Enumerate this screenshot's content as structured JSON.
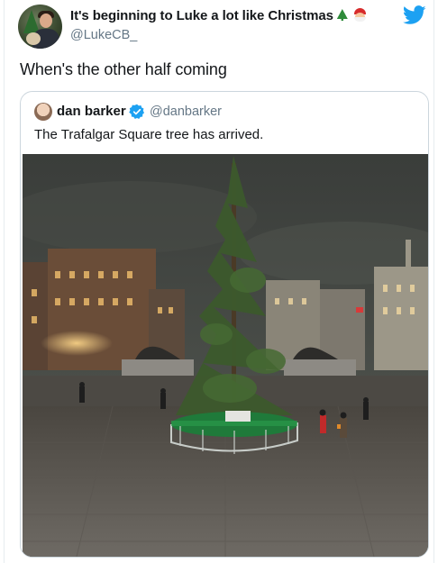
{
  "tweet": {
    "author": {
      "display_name": "It's beginning to Luke a lot like Christmas",
      "handle": "@LukeCB_",
      "name_emojis": [
        "christmas-tree-emoji",
        "santa-emoji"
      ]
    },
    "text": "When's the other half coming",
    "logo_icon": "twitter-bird-icon",
    "brand_color": "#1da1f2"
  },
  "quoted_tweet": {
    "author": {
      "display_name": "dan barker",
      "handle": "@danbarker",
      "verified": true,
      "verified_icon": "verified-badge-icon"
    },
    "text": "The Trafalgar Square tree has arrived.",
    "media": {
      "type": "photo",
      "subject": "tall sparse christmas tree at night in a square with green barrier"
    }
  }
}
